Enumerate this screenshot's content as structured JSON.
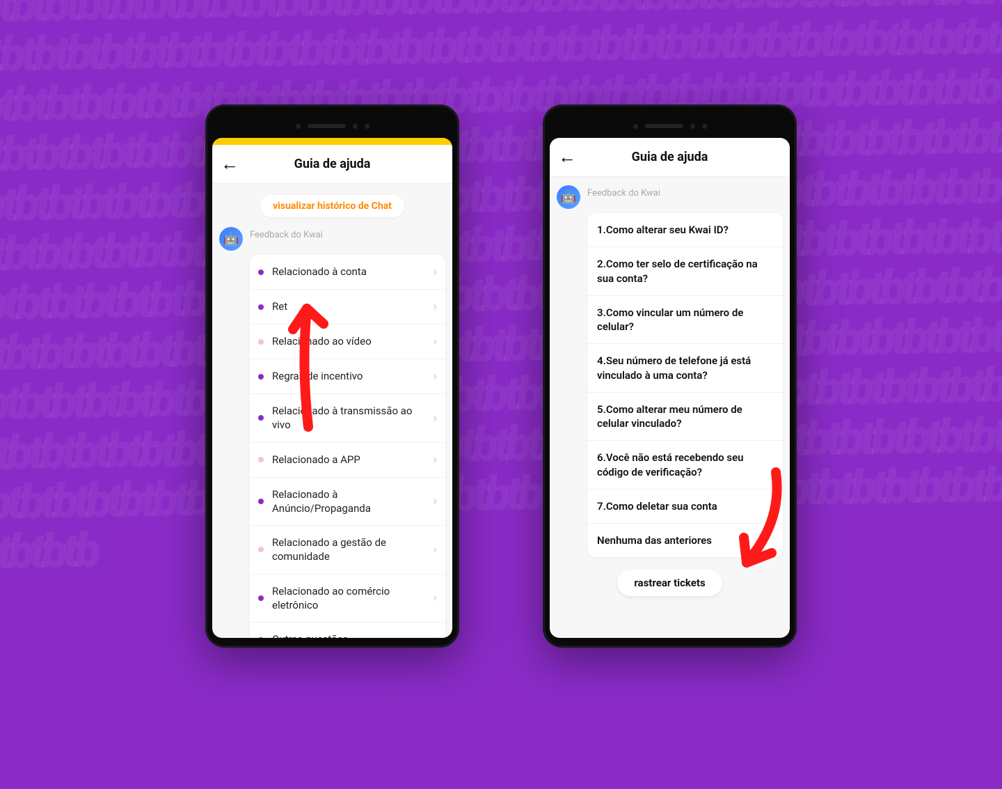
{
  "header": {
    "title": "Guia de ajuda"
  },
  "chip": {
    "history": "visualizar histórico de Chat"
  },
  "bot": {
    "label": "Feedback do Kwai"
  },
  "categories": [
    {
      "label": "Relacionado à conta",
      "dot": "purple"
    },
    {
      "label": "Ret",
      "dot": "purple"
    },
    {
      "label": "Relacionado ao vídeo",
      "dot": "pink"
    },
    {
      "label": "Regras de incentivo",
      "dot": "purple"
    },
    {
      "label": "Relacionado à transmissão ao vivo",
      "dot": "purple"
    },
    {
      "label": "Relacionado a APP",
      "dot": "pink"
    },
    {
      "label": "Relacionado à Anúncio/Propaganda",
      "dot": "purple"
    },
    {
      "label": "Relacionado a gestão de comunidade",
      "dot": "pink"
    },
    {
      "label": "Relacionado ao comércio eletrônico",
      "dot": "purple"
    },
    {
      "label": "Outras questões",
      "dot": "purple"
    }
  ],
  "questions": [
    "1.Como alterar seu Kwai ID?",
    "2.Como ter selo de certificação na sua conta?",
    "3.Como vincular um número de celular?",
    "4.Seu número de telefone já está vinculado à uma conta?",
    "5.Como alterar meu número de celular vinculado?",
    "6.Você não está recebendo seu código de verificação?",
    "7.Como deletar sua conta",
    "Nenhuma das anteriores"
  ],
  "footer": {
    "track": "rastrear tickets"
  }
}
